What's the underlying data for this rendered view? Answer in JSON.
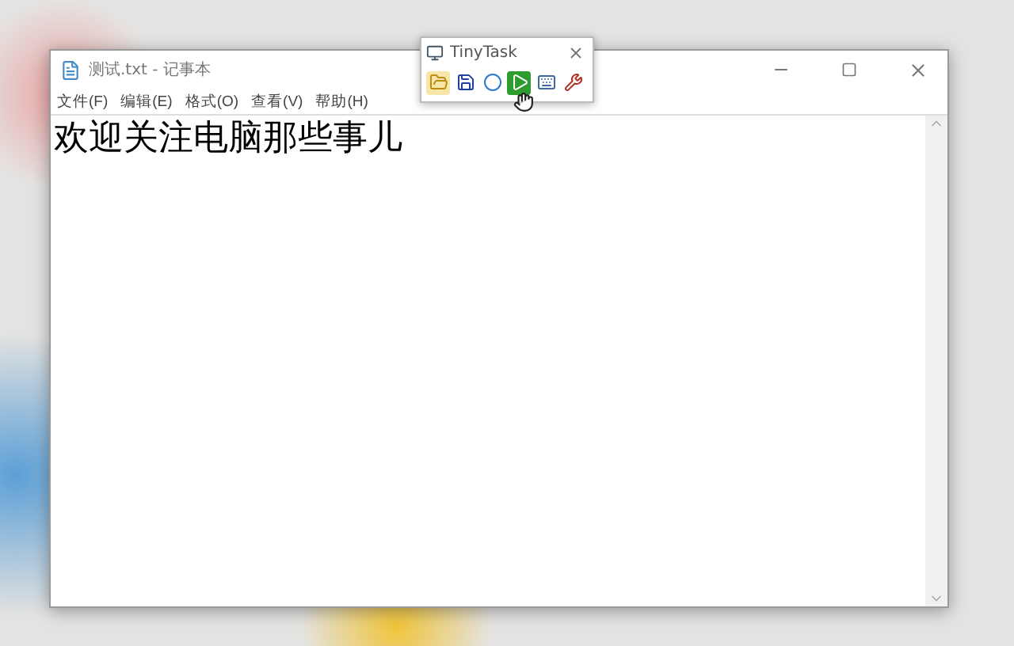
{
  "notepad": {
    "title": "测试.txt - 记事本",
    "menus": [
      "文件(F)",
      "编辑(E)",
      "格式(O)",
      "查看(V)",
      "帮助(H)"
    ],
    "content": "欢迎关注电脑那些事儿"
  },
  "tinytask": {
    "title": "TinyTask",
    "tools": [
      {
        "kind": "open"
      },
      {
        "kind": "save"
      },
      {
        "kind": "record"
      },
      {
        "kind": "play"
      },
      {
        "kind": "compile"
      },
      {
        "kind": "prefs"
      }
    ]
  }
}
